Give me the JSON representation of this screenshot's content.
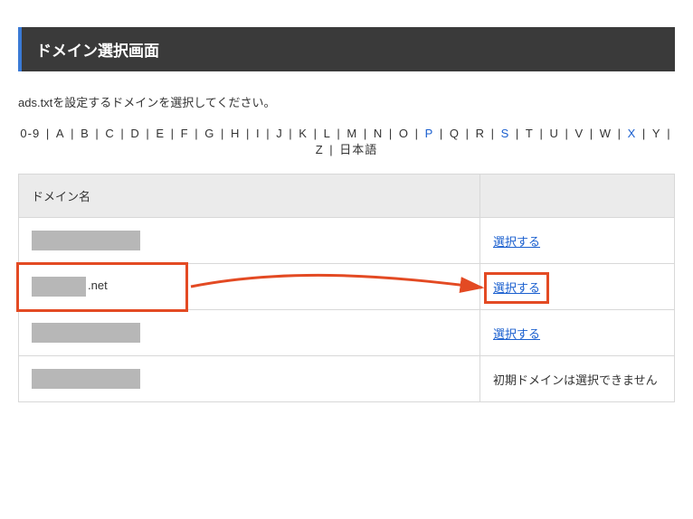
{
  "titleBar": {
    "title": "ドメイン選択画面"
  },
  "instruction": "ads.txtを設定するドメインを選択してください。",
  "alphaNav": {
    "items": [
      {
        "label": "0-9",
        "active": false
      },
      {
        "label": "A",
        "active": false
      },
      {
        "label": "B",
        "active": false
      },
      {
        "label": "C",
        "active": false
      },
      {
        "label": "D",
        "active": false
      },
      {
        "label": "E",
        "active": false
      },
      {
        "label": "F",
        "active": false
      },
      {
        "label": "G",
        "active": false
      },
      {
        "label": "H",
        "active": false
      },
      {
        "label": "I",
        "active": false
      },
      {
        "label": "J",
        "active": false
      },
      {
        "label": "K",
        "active": false
      },
      {
        "label": "L",
        "active": false
      },
      {
        "label": "M",
        "active": false
      },
      {
        "label": "N",
        "active": false
      },
      {
        "label": "O",
        "active": false
      },
      {
        "label": "P",
        "active": true
      },
      {
        "label": "Q",
        "active": false
      },
      {
        "label": "R",
        "active": false
      },
      {
        "label": "S",
        "active": true
      },
      {
        "label": "T",
        "active": false
      },
      {
        "label": "U",
        "active": false
      },
      {
        "label": "V",
        "active": false
      },
      {
        "label": "W",
        "active": false
      },
      {
        "label": "X",
        "active": true
      },
      {
        "label": "Y",
        "active": false
      },
      {
        "label": "Z",
        "active": false
      },
      {
        "label": "日本語",
        "active": false
      }
    ]
  },
  "table": {
    "headers": {
      "domain": "ドメイン名",
      "action": ""
    },
    "rows": [
      {
        "domainSuffix": "",
        "maskClass": "mask-w1",
        "actionLabel": "選択する",
        "enabled": true
      },
      {
        "domainSuffix": ".net",
        "maskClass": "mask-w2",
        "actionLabel": "選択する",
        "enabled": true
      },
      {
        "domainSuffix": "",
        "maskClass": "mask-w1",
        "actionLabel": "選択する",
        "enabled": true
      },
      {
        "domainSuffix": "",
        "maskClass": "mask-w1",
        "actionLabel": "初期ドメインは選択できません",
        "enabled": false
      }
    ]
  },
  "annotation": {
    "highlight_domain_row": 1,
    "highlight_action_row": 1
  }
}
